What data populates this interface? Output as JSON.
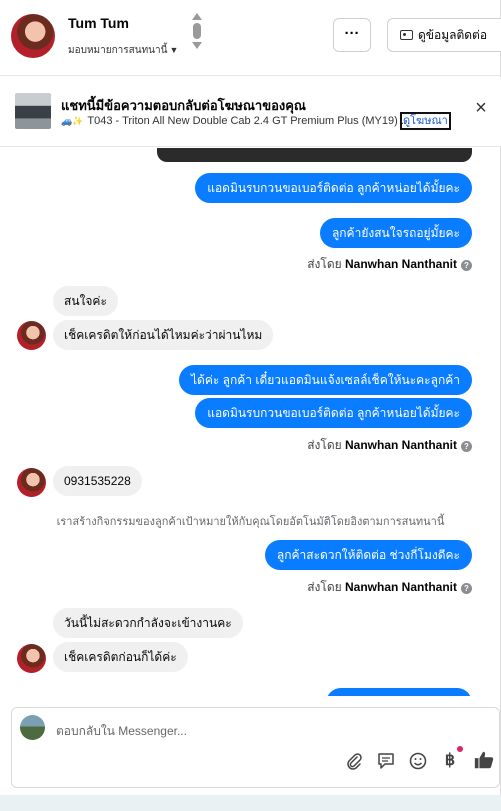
{
  "header": {
    "name": "Tum Tum",
    "assign_label": "มอบหมายการสนทนานี้",
    "more_label": "···",
    "contact_info_label": "ดูข้อมูลติดต่อ"
  },
  "ad": {
    "title": "แชทนี้มีข้อความตอบกลับต่อโฆษณาของคุณ",
    "subtitle": "T043 - Triton All New Double Cab 2.4 GT Premium Plus (MY19) ...",
    "link_label": "ดูโฆษณา",
    "close_label": "×"
  },
  "messages": [
    {
      "from": "page",
      "text": "แอดมินรบกวนขอเบอร์ติดต่อ ลูกค้าหน่อยได้มั้ยคะ"
    },
    {
      "from": "page",
      "text": "ลูกค้ายังสนใจรถอยู่มั้ยคะ"
    },
    {
      "type": "sent_by",
      "prefix": "ส่งโดย",
      "name": "Nanwhan Nanthanit"
    },
    {
      "from": "user",
      "text": "สนใจค่ะ"
    },
    {
      "from": "user",
      "text": "เช็คเครดิตให้ก่อนได้ไหมค่ะว่าผ่านไหม"
    },
    {
      "from": "page",
      "text": "ได้ค่ะ  ลูกค้า  เดี๋ยวแอดมินแจ้งเซลล์เช็คให้นะคะลูกค้า"
    },
    {
      "from": "page",
      "text": "แอดมินรบกวนขอเบอร์ติดต่อ ลูกค้าหน่อยได้มั้ยคะ"
    },
    {
      "type": "sent_by",
      "prefix": "ส่งโดย",
      "name": "Nanwhan Nanthanit"
    },
    {
      "from": "user",
      "text": "0931535228"
    },
    {
      "type": "notice",
      "text": "เราสร้างกิจกรรมของลูกค้าเป้าหมายให้กับคุณโดยอัตโนมัติโดยอิงตามการสนทนานี้"
    },
    {
      "from": "page",
      "text": "ลูกค้าสะดวกให้ติดต่อ ช่วงกี่โมงดีคะ"
    },
    {
      "type": "sent_by",
      "prefix": "ส่งโดย",
      "name": "Nanwhan Nanthanit"
    },
    {
      "from": "user",
      "text": "วันนี้ไม่สะดวกกำลังจะเข้างานคะ"
    },
    {
      "from": "user",
      "text": "เช็คเครดิตก่อนก็ได้ค่ะ"
    }
  ],
  "composer": {
    "placeholder": "ตอบกลับใน Messenger...",
    "icons": [
      "paperclip-icon",
      "saved-reply-icon",
      "emoji-icon",
      "baht-icon",
      "thumbs-up-icon"
    ]
  },
  "colors": {
    "accent": "#0a7cff",
    "incoming_bubble": "#f0f0f0",
    "link": "#1a59c8"
  }
}
